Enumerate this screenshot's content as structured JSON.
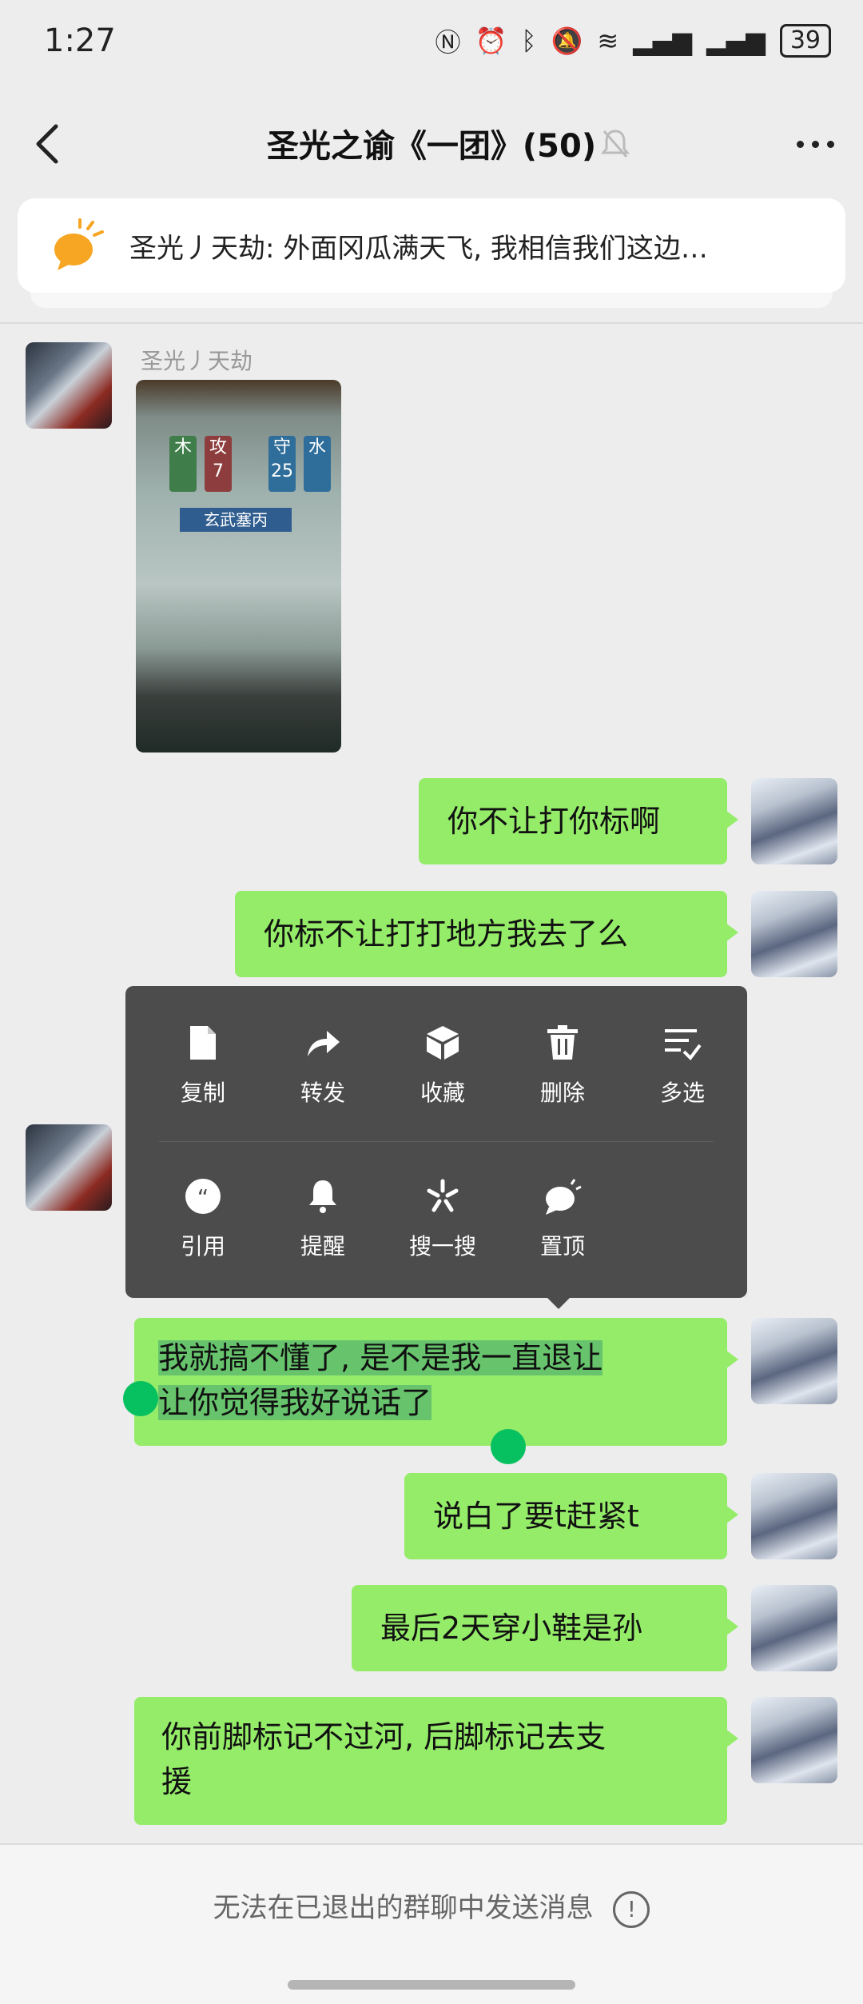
{
  "status_bar": {
    "time": "1:27",
    "battery": "39"
  },
  "header": {
    "title": "圣光之谕《一团》(50)"
  },
  "notice": {
    "text": "圣光丿天劫: 外面冈瓜满天飞, 我相信我们这边…"
  },
  "sender_name": "圣光丿天劫",
  "image_message": {
    "tiles": [
      "木",
      "攻7",
      "守25",
      "水"
    ],
    "banner": "玄武塞丙"
  },
  "messages": [
    {
      "text": "你不让打你标啊"
    },
    {
      "text": "你标不让打打地方我去了么"
    },
    {
      "line1": "我就搞不懂了, 是不是我一直退让",
      "line2": "让你觉得我好说话了"
    },
    {
      "text": "说白了要t赶紧t"
    },
    {
      "text": "最后2天穿小鞋是孙"
    },
    {
      "line1": "你前脚标记不过河, 后脚标记去支",
      "line2": "援"
    }
  ],
  "context_menu": {
    "row1": [
      "复制",
      "转发",
      "收藏",
      "删除",
      "多选"
    ],
    "row2": [
      "引用",
      "提醒",
      "搜一搜",
      "置顶"
    ]
  },
  "bottom": {
    "text": "无法在已退出的群聊中发送消息",
    "info": "!"
  },
  "colors": {
    "bubble": "#95ec69",
    "menu": "#4c4c4c",
    "accent": "#07c160",
    "background": "#ededed"
  }
}
